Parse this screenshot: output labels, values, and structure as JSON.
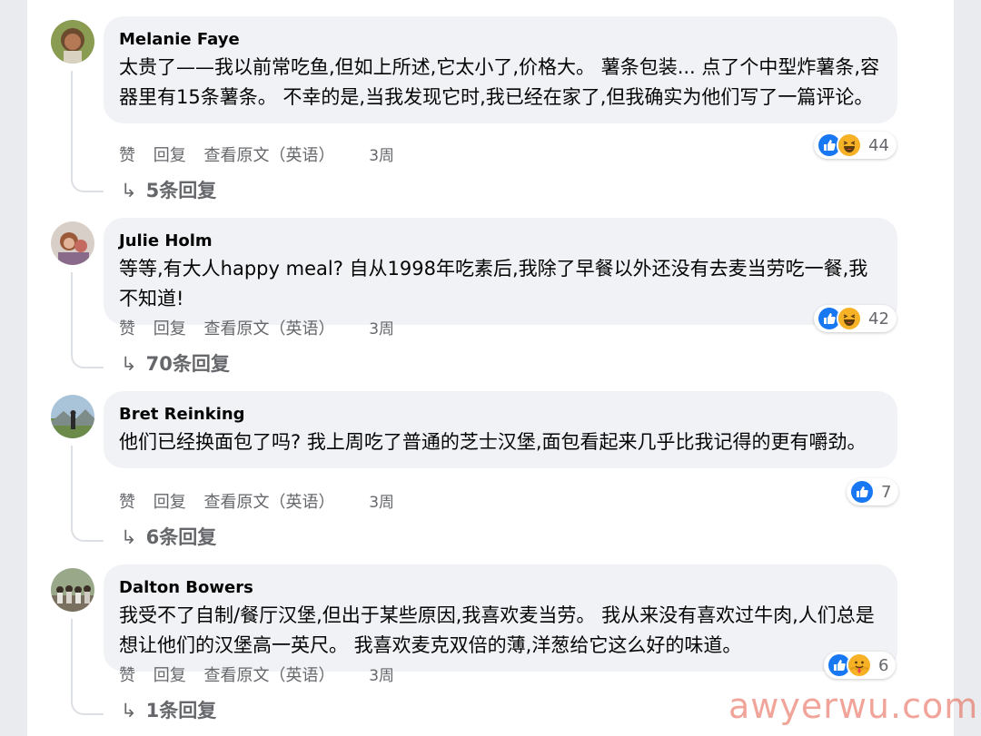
{
  "actions": {
    "like": "赞",
    "reply": "回复",
    "translate": "查看原文（英语）"
  },
  "comments": [
    {
      "author": "Melanie Faye",
      "text": "太贵了——我以前常吃鱼,但如上所述,它太小了,价格大。 薯条包装... 点了个中型炸薯条,容器里有15条薯条。 不幸的是,当我发现它时,我已经在家了,但我确实为他们写了一篇评论。",
      "time": "3周",
      "reaction_count": "44",
      "reactions": [
        "like-icon",
        "haha-icon"
      ],
      "replies": "5条回复"
    },
    {
      "author": "Julie Holm",
      "text": "等等,有大人happy meal? 自从1998年吃素后,我除了早餐以外还没有去麦当劳吃一餐,我不知道!",
      "time": "3周",
      "reaction_count": "42",
      "reactions": [
        "like-icon",
        "haha-icon"
      ],
      "replies": "70条回复"
    },
    {
      "author": "Bret Reinking",
      "text": "他们已经换面包了吗? 我上周吃了普通的芝士汉堡,面包看起来几乎比我记得的更有嚼劲。",
      "time": "3周",
      "reaction_count": "7",
      "reactions": [
        "like-icon"
      ],
      "replies": "6条回复"
    },
    {
      "author": "Dalton Bowers",
      "text": "我受不了自制/餐厅汉堡,但出于某些原因,我喜欢麦当劳。 我从来没有喜欢过牛肉,人们总是想让他们的汉堡高一英尺。 我喜欢麦克双倍的薄,洋葱给它这么好的味道。",
      "time": "3周",
      "reaction_count": "6",
      "reactions": [
        "like-icon",
        "care-icon"
      ],
      "replies": "1条回复"
    }
  ],
  "watermark": "awyerwu.com",
  "colors": {
    "like": "#1877f2",
    "haha": "#f7b125",
    "bubble": "#f0f2f5",
    "meta": "#65676b"
  }
}
